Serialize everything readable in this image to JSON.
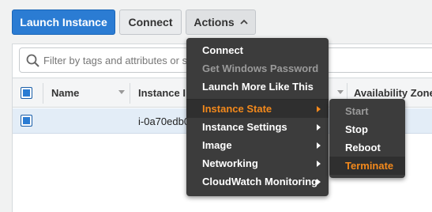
{
  "toolbar": {
    "launch_label": "Launch Instance",
    "connect_label": "Connect",
    "actions_label": "Actions"
  },
  "filter": {
    "placeholder": "Filter by tags and attributes or s"
  },
  "table": {
    "columns": [
      "Name",
      "Instance I",
      "Availability Zone"
    ],
    "rows": [
      {
        "instance_id": "i-0a70edb0"
      }
    ]
  },
  "actions_menu": {
    "items": [
      {
        "label": "Connect",
        "state": "enabled"
      },
      {
        "label": "Get Windows Password",
        "state": "disabled"
      },
      {
        "label": "Launch More Like This",
        "state": "enabled"
      },
      {
        "label": "Instance State",
        "state": "active",
        "submenu": true
      },
      {
        "label": "Instance Settings",
        "state": "enabled",
        "submenu": true
      },
      {
        "label": "Image",
        "state": "enabled",
        "submenu": true
      },
      {
        "label": "Networking",
        "state": "enabled",
        "submenu": true
      },
      {
        "label": "CloudWatch Monitoring",
        "state": "enabled",
        "submenu": true
      }
    ]
  },
  "instance_state_submenu": {
    "items": [
      {
        "label": "Start",
        "state": "disabled"
      },
      {
        "label": "Stop",
        "state": "enabled"
      },
      {
        "label": "Reboot",
        "state": "enabled"
      },
      {
        "label": "Terminate",
        "state": "active"
      }
    ]
  },
  "colors": {
    "primary": "#2b7cd3",
    "menu_bg": "#3c3c3c",
    "menu_active": "#f3891c",
    "disabled": "#9a9a9a"
  }
}
